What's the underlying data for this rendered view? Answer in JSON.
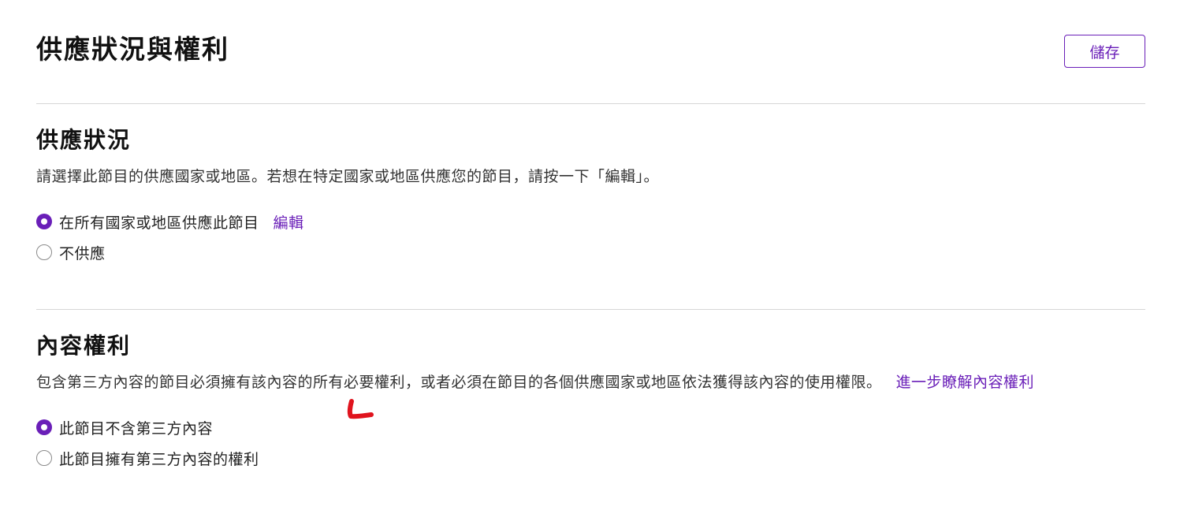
{
  "header": {
    "title": "供應狀況與權利",
    "save_label": "儲存"
  },
  "availability": {
    "heading": "供應狀況",
    "description": "請選擇此節目的供應國家或地區。若想在特定國家或地區供應您的節目，請按一下「編輯」。",
    "options": [
      {
        "label": "在所有國家或地區供應此節目",
        "checked": true,
        "edit_label": "編輯"
      },
      {
        "label": "不供應",
        "checked": false
      }
    ]
  },
  "content_rights": {
    "heading": "內容權利",
    "description": "包含第三方內容的節目必須擁有該內容的所有必要權利，或者必須在節目的各個供應國家或地區依法獲得該內容的使用權限。",
    "learn_more_label": "進一步瞭解內容權利",
    "options": [
      {
        "label": "此節目不含第三方內容",
        "checked": true
      },
      {
        "label": "此節目擁有第三方內容的權利",
        "checked": false
      }
    ]
  },
  "colors": {
    "accent": "#6a1fb8",
    "annotation": "#e0141e",
    "divider": "#d6d6d6"
  }
}
